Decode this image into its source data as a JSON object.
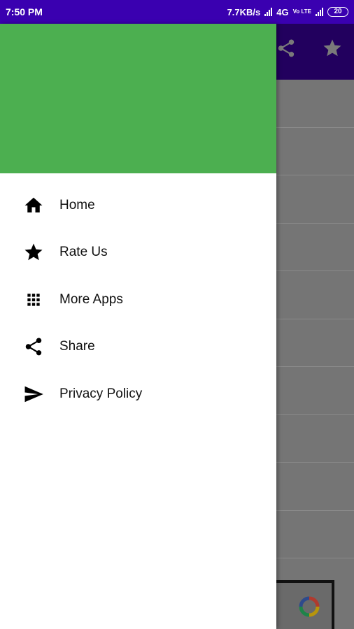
{
  "status_bar": {
    "time": "7:50 PM",
    "net_speed": "7.7KB/s",
    "network": "4G",
    "volte": "Vo LTE",
    "battery": "20"
  },
  "drawer": {
    "header_color": "#4caf50",
    "items": [
      {
        "label": "Home",
        "icon": "home-icon"
      },
      {
        "label": "Rate Us",
        "icon": "star-icon"
      },
      {
        "label": "More Apps",
        "icon": "apps-grid-icon"
      },
      {
        "label": "Share",
        "icon": "share-icon"
      },
      {
        "label": "Privacy Policy",
        "icon": "send-icon"
      }
    ]
  },
  "background_app": {
    "app_bar_actions": [
      "share-icon",
      "star-icon"
    ],
    "accent_color": "#3a00b0"
  }
}
